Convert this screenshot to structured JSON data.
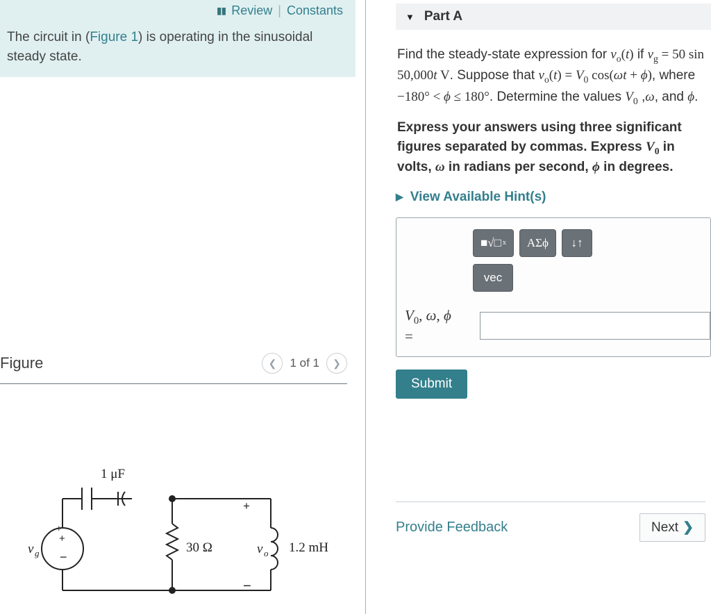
{
  "topbar": {
    "review": "Review",
    "constants": "Constants"
  },
  "intro": {
    "pre": "The circuit in (",
    "figlink": "Figure 1",
    "post": ") is operating in the sinusoidal steady state."
  },
  "figure": {
    "title": "Figure",
    "counter": "1 of 1",
    "labels": {
      "cap": "1 μF",
      "res": "30 Ω",
      "ind": "1.2 mH",
      "src": "vg",
      "out": "vo"
    }
  },
  "part": {
    "label": "Part A",
    "prompt_html": "Find the steady-state expression for <span class='math'><i>v</i><sub>o</sub>(<i>t</i>)</span> if <span class='math'><i>v</i><sub>g</sub> = 50 sin 50,000<i>t</i> V</span>. Suppose that <span class='math'><i>v</i><sub>o</sub>(<i>t</i>) = <i>V</i><sub>0</sub> cos(<i>ωt</i> + <i>ϕ</i>)</span>, where <span class='math'>−180° &lt; <i>ϕ</i> ≤ 180°</span>. Determine the values <span class='math'><i>V</i><sub>0</sub></span> ,<span class='math'><i>ω</i></span>, and <span class='math'><i>ϕ</i></span>.",
    "instructions_html": "Express your answers using three significant figures separated by commas. Express <span class='math' style='font-weight:bold;'><i>V</i><sub>0</sub></span> in volts, <span class='math' style='font-weight:bold;'><i>ω</i></span> in radians per second, <span class='math' style='font-weight:bold;'><i>ϕ</i></span> in degrees.",
    "hints": "View Available Hint(s)",
    "toolbar": {
      "templates": "■√□",
      "greek": "ΑΣϕ",
      "undo": "↓↑",
      "vec": "vec"
    },
    "answer_vars_html": "<i>V</i><sub>0</sub>, <i>ω</i>, <i>ϕ</i><br>=",
    "submit": "Submit"
  },
  "footer": {
    "feedback": "Provide Feedback",
    "next": "Next"
  }
}
